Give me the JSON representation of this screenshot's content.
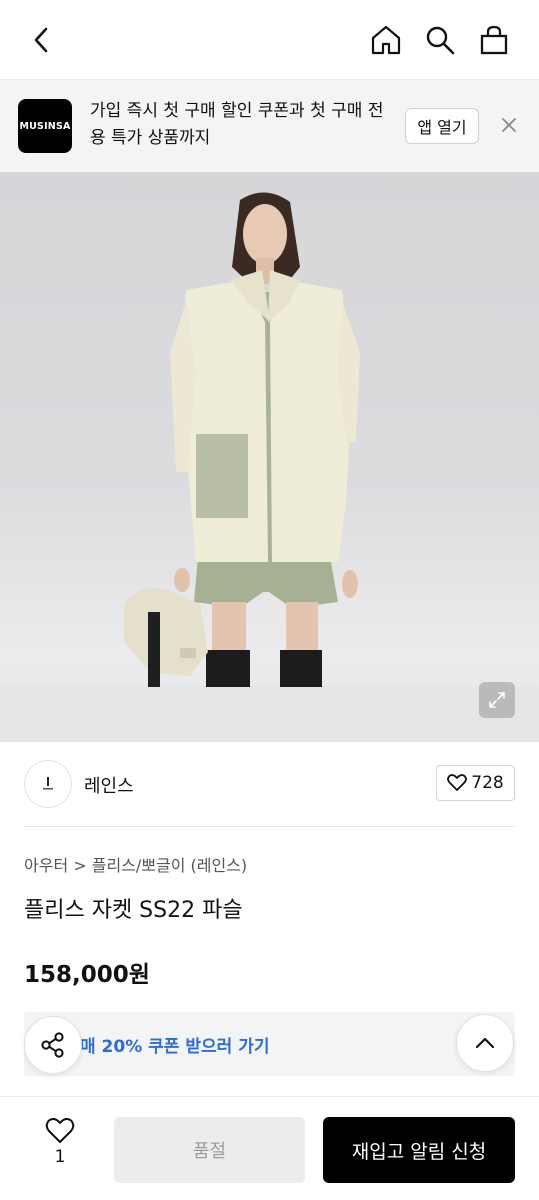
{
  "banner": {
    "logo_text": "MUSINSA",
    "message": "가입 즉시 첫 구매 할인 쿠폰과 첫 구매 전용 특가 상품까지",
    "open_label": "앱 열기"
  },
  "brand": {
    "name": "레인스",
    "likes": "728"
  },
  "product": {
    "breadcrumb": "아우터 > 플리스/뽀글이 (레인스)",
    "title": "플리스 자켓 SS22 파슬",
    "price": "158,000원",
    "coupon_text": "매 20% 쿠폰 받으러 가기"
  },
  "bottom": {
    "wish_count": "1",
    "soldout_label": "품절",
    "restock_label": "재입고 알림 신청"
  },
  "colors": {
    "coupon_link": "#2d6bd6",
    "primary_button": "#000000",
    "disabled_button": "#ececec"
  },
  "icons": {
    "back": "chevron-left-icon",
    "home": "home-icon",
    "search": "search-icon",
    "cart": "shopping-bag-icon",
    "close": "close-icon",
    "expand": "expand-icon",
    "like": "heart-icon",
    "share": "share-icon",
    "top": "chevron-up-icon"
  }
}
